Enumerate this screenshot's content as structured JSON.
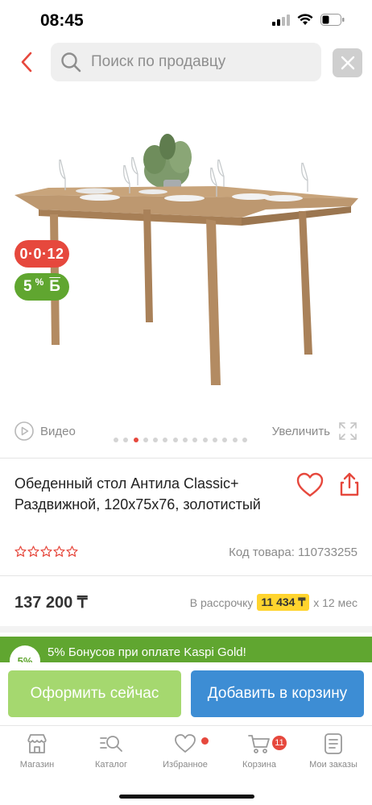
{
  "status_bar": {
    "time": "08:45"
  },
  "search": {
    "placeholder": "Поиск по продавцу"
  },
  "gallery": {
    "badges": {
      "installment": "0·0·12",
      "bonus_percent": "5",
      "bonus_sup": "%",
      "bonus_currency": "Б"
    },
    "video_label": "Видео",
    "zoom_label": "Увеличить",
    "dots_total": 14,
    "active_dot": 2
  },
  "product": {
    "title": "Обеденный стол Антила Classic+ Раздвижной, 120x75x76, золотистый",
    "rating_stars": 5,
    "sku": "Код товара: 110733255"
  },
  "pricing": {
    "price": "137 200 ₸",
    "installment_prefix": "В рассрочку",
    "monthly": "11 434 ₸",
    "installment_suffix": "x 12 мес"
  },
  "promo": {
    "badge": "5%",
    "text": "5% Бонусов при оплате Kaspi Gold!"
  },
  "actions": {
    "checkout": "Оформить сейчас",
    "add_to_cart": "Добавить в корзину"
  },
  "tab_bar": {
    "items": [
      {
        "label": "Магазин",
        "icon": "store-icon"
      },
      {
        "label": "Каталог",
        "icon": "catalog-search-icon"
      },
      {
        "label": "Избранное",
        "icon": "heart-icon"
      },
      {
        "label": "Корзина",
        "icon": "cart-icon"
      },
      {
        "label": "Мои заказы",
        "icon": "orders-icon"
      }
    ],
    "cart_count": "11"
  },
  "colors": {
    "accent_red": "#e6483d",
    "kaspi_green": "#60a630",
    "checkout_green": "#a5d86f",
    "cart_blue": "#3d8dd4",
    "installment_yellow": "#ffd42e"
  }
}
